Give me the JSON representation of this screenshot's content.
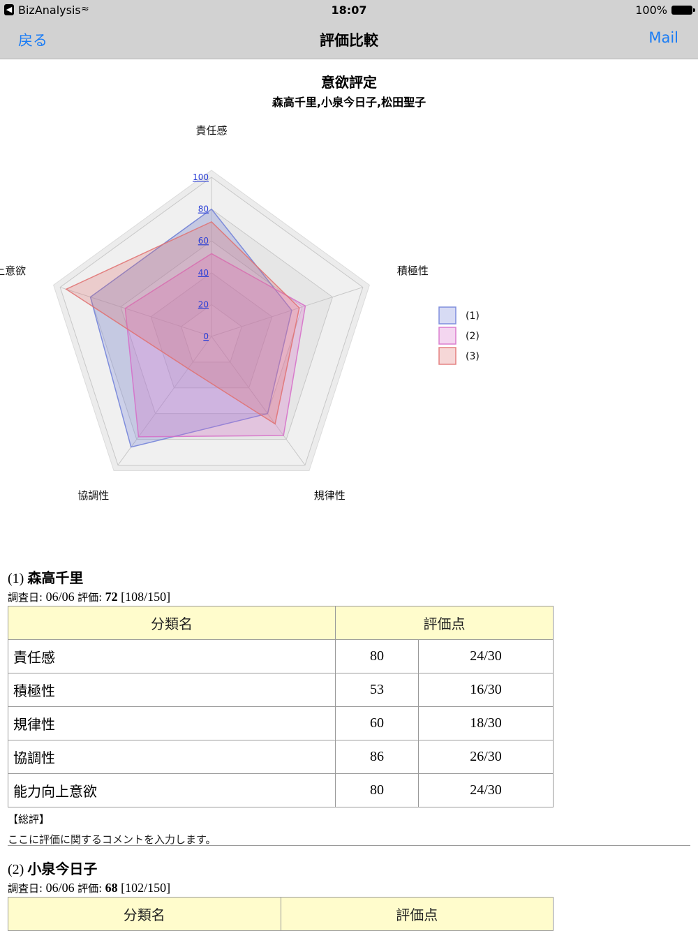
{
  "status_bar": {
    "app": "BizAnalysis",
    "time": "18:07",
    "battery": "100%"
  },
  "nav": {
    "back": "戻る",
    "title": "評価比較",
    "mail": "Mail"
  },
  "chart_data": {
    "type": "radar",
    "title": "意欲評定",
    "subtitle": "森高千里,小泉今日子,松田聖子",
    "axes": [
      "責任感",
      "積極性",
      "規律性",
      "協調性",
      "能力向上意欲"
    ],
    "ticks": [
      "0",
      "20",
      "40",
      "60",
      "80",
      "100"
    ],
    "range": [
      0,
      100
    ],
    "series": [
      {
        "name": "(1)",
        "values": [
          80,
          53,
          60,
          86,
          80
        ],
        "color": "#6f7fd8"
      },
      {
        "name": "(2)",
        "values": [
          52,
          62,
          77,
          78,
          57
        ],
        "color": "#d66cc8"
      },
      {
        "name": "(3)",
        "values": [
          72,
          58,
          68,
          25,
          96
        ],
        "color": "#e07070"
      }
    ],
    "legend": "right"
  },
  "sections": [
    {
      "index": "(1)",
      "name": "森高千里",
      "date_label": "調査日:",
      "date": "06/06",
      "eval_label": "評価:",
      "score": "72",
      "total": "[108/150]",
      "table_headers": [
        "分類名",
        "評価点"
      ],
      "rows": [
        {
          "name": "責任感",
          "score": "80",
          "frac": "24/30"
        },
        {
          "name": "積極性",
          "score": "53",
          "frac": "16/30"
        },
        {
          "name": "規律性",
          "score": "60",
          "frac": "18/30"
        },
        {
          "name": "協調性",
          "score": "86",
          "frac": "26/30"
        },
        {
          "name": "能力向上意欲",
          "score": "80",
          "frac": "24/30"
        }
      ],
      "comment_heading": "【総評】",
      "comment": "ここに評価に関するコメントを入力します。"
    },
    {
      "index": "(2)",
      "name": "小泉今日子",
      "date_label": "調査日:",
      "date": "06/06",
      "eval_label": "評価:",
      "score": "68",
      "total": "[102/150]",
      "table_headers": [
        "分類名",
        "評価点"
      ]
    }
  ]
}
